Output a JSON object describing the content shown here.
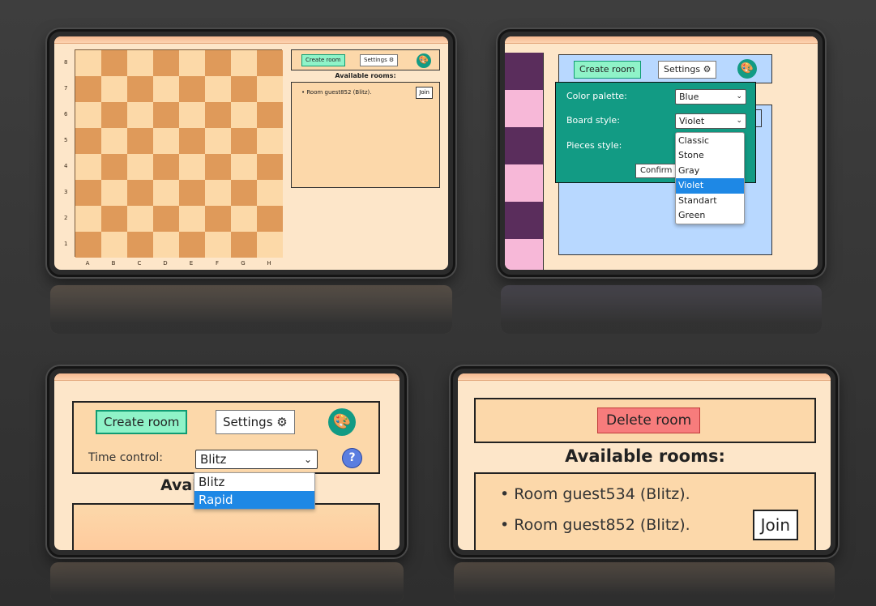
{
  "panel1": {
    "create_label": "Create room",
    "settings_label": "Settings ⚙",
    "palette_icon": "🎨",
    "available_heading": "Available rooms:",
    "room": "Room guest852 (Blitz).",
    "join_label": "Join",
    "ranks": [
      "8",
      "7",
      "6",
      "5",
      "4",
      "3",
      "2",
      "1"
    ],
    "files": [
      "A",
      "B",
      "C",
      "D",
      "E",
      "F",
      "G",
      "H"
    ],
    "light_color": "#fcd9a8",
    "dark_color": "#df9a5a"
  },
  "panel2": {
    "create_label": "Create room",
    "settings_label": "Settings ⚙",
    "palette_icon": "🎨",
    "color_palette_label": "Color palette:",
    "color_palette_value": "Blue",
    "board_style_label": "Board style:",
    "board_style_value": "Violet",
    "pieces_style_label": "Pieces style:",
    "confirm_label": "Confirm",
    "options": [
      "Classic",
      "Stone",
      "Gray",
      "Violet",
      "Standart",
      "Green"
    ],
    "selected_option": "Violet"
  },
  "panel3": {
    "create_label": "Create room",
    "settings_label": "Settings ⚙",
    "palette_icon": "🎨",
    "time_control_label": "Time control:",
    "time_control_value": "Blitz",
    "help_icon": "?",
    "available_heading": "Avai",
    "options": [
      "Blitz",
      "Rapid"
    ],
    "selected_option": "Rapid"
  },
  "panel4": {
    "delete_label": "Delete room",
    "available_heading": "Available rooms:",
    "rooms": [
      "Room guest534 (Blitz).",
      "Room guest852 (Blitz)."
    ],
    "join_label": "Join"
  }
}
